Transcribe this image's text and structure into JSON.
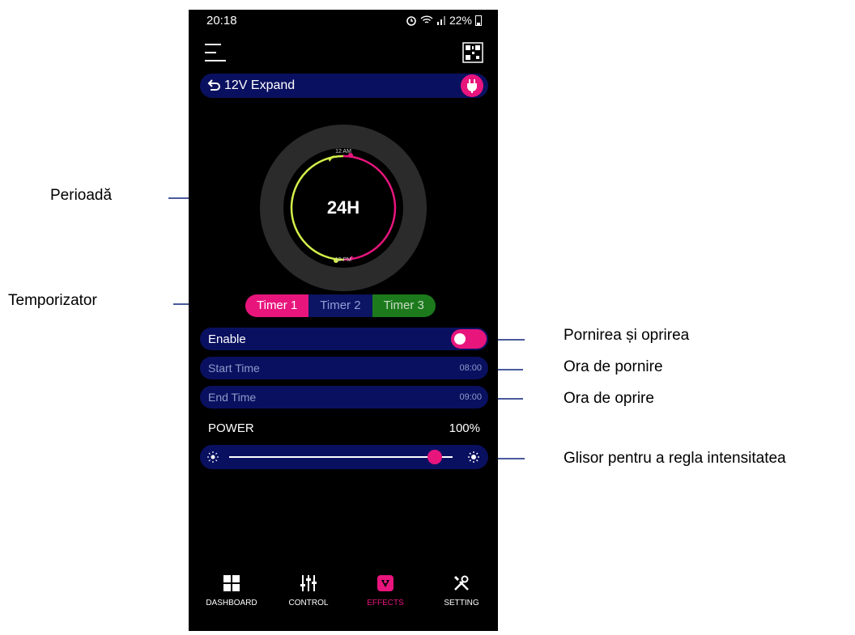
{
  "status_bar": {
    "time": "20:18",
    "battery": "22%"
  },
  "device": {
    "name": "12V Expand"
  },
  "dial": {
    "label": "24H",
    "top_label": "12 AM",
    "bottom_label": "12 PM"
  },
  "timers": [
    {
      "label": "Timer 1",
      "active": true,
      "color": "#e8157d"
    },
    {
      "label": "Timer 2",
      "active": false,
      "color": "#0c1464"
    },
    {
      "label": "Timer 3",
      "active": false,
      "color": "#1c7a1c"
    }
  ],
  "enable": {
    "label": "Enable",
    "on": true
  },
  "start_time": {
    "label": "Start Time",
    "value": "08:00"
  },
  "end_time": {
    "label": "End Time",
    "value": "09:00"
  },
  "power": {
    "label": "POWER",
    "value": "100%",
    "level": 0.92
  },
  "nav": [
    {
      "label": "DASHBOARD",
      "icon": "grid-icon",
      "active": false
    },
    {
      "label": "CONTROL",
      "icon": "sliders-icon",
      "active": false
    },
    {
      "label": "EFFECTS",
      "icon": "effects-icon",
      "active": true
    },
    {
      "label": "SETTING",
      "icon": "tools-icon",
      "active": false
    }
  ],
  "annotations": {
    "period": "Perioadă",
    "timer": "Temporizator",
    "enable": "Pornirea și oprirea",
    "start": "Ora de pornire",
    "end": "Ora de oprire",
    "slider": "Glisor pentru a regla intensitatea"
  },
  "colors": {
    "accent": "#e8157d",
    "panel": "#0a1060",
    "arc_green": "#d4f04a"
  }
}
